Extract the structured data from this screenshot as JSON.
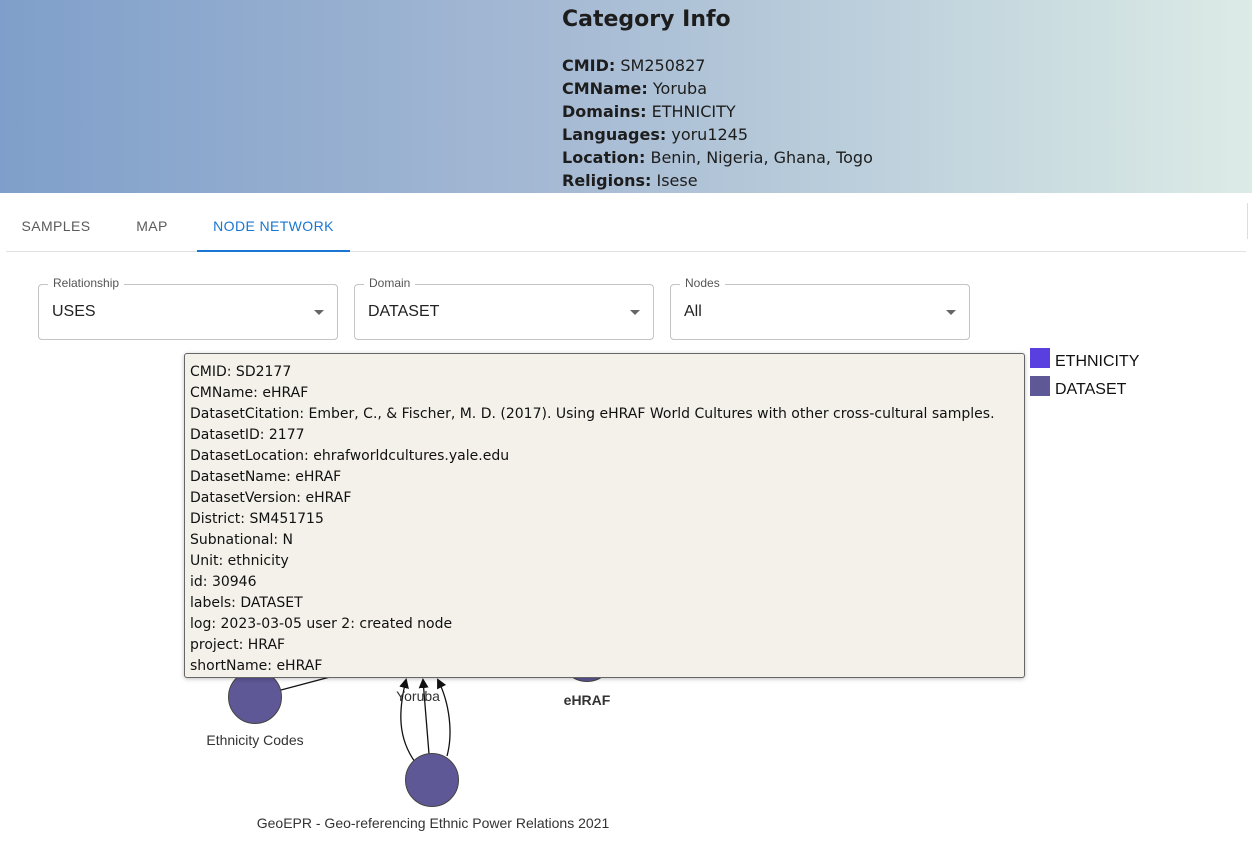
{
  "category_info": {
    "title": "Category Info",
    "fields": [
      {
        "label": "CMID:",
        "value": "SM250827"
      },
      {
        "label": "CMName:",
        "value": "Yoruba"
      },
      {
        "label": "Domains:",
        "value": "ETHNICITY"
      },
      {
        "label": "Languages:",
        "value": "yoru1245"
      },
      {
        "label": "Location:",
        "value": "Benin, Nigeria, Ghana, Togo"
      },
      {
        "label": "Religions:",
        "value": "Isese"
      }
    ]
  },
  "tabs": [
    {
      "label": "SAMPLES"
    },
    {
      "label": "MAP"
    },
    {
      "label": "NODE NETWORK",
      "active": true
    }
  ],
  "filters": {
    "relationship": {
      "label": "Relationship",
      "value": "USES"
    },
    "domain": {
      "label": "Domain",
      "value": "DATASET"
    },
    "nodes": {
      "label": "Nodes",
      "value": "All"
    }
  },
  "legend": [
    {
      "label": "ETHNICITY",
      "color": "#5a3fe0"
    },
    {
      "label": "DATASET",
      "color": "#5e5896"
    }
  ],
  "graph": {
    "nodes": [
      {
        "label": "Ethnicity Codes"
      },
      {
        "label": "Yoruba"
      },
      {
        "label": "eHRAF"
      },
      {
        "label": "GeoEPR - Geo-referencing Ethnic Power Relations 2021"
      }
    ]
  },
  "tooltip": {
    "lines": [
      "CMID: SD2177",
      "CMName: eHRAF",
      "DatasetCitation: Ember, C., & Fischer, M. D. (2017). Using eHRAF World Cultures with other cross-cultural samples.",
      "DatasetID: 2177",
      "DatasetLocation: ehrafworldcultures.yale.edu",
      "DatasetName: eHRAF",
      "DatasetVersion: eHRAF",
      "District: SM451715",
      "Subnational: N",
      "Unit: ethnicity",
      "id: 30946",
      "labels: DATASET",
      "log: 2023-03-05 user 2: created node",
      "project: HRAF",
      "shortName: eHRAF"
    ]
  }
}
